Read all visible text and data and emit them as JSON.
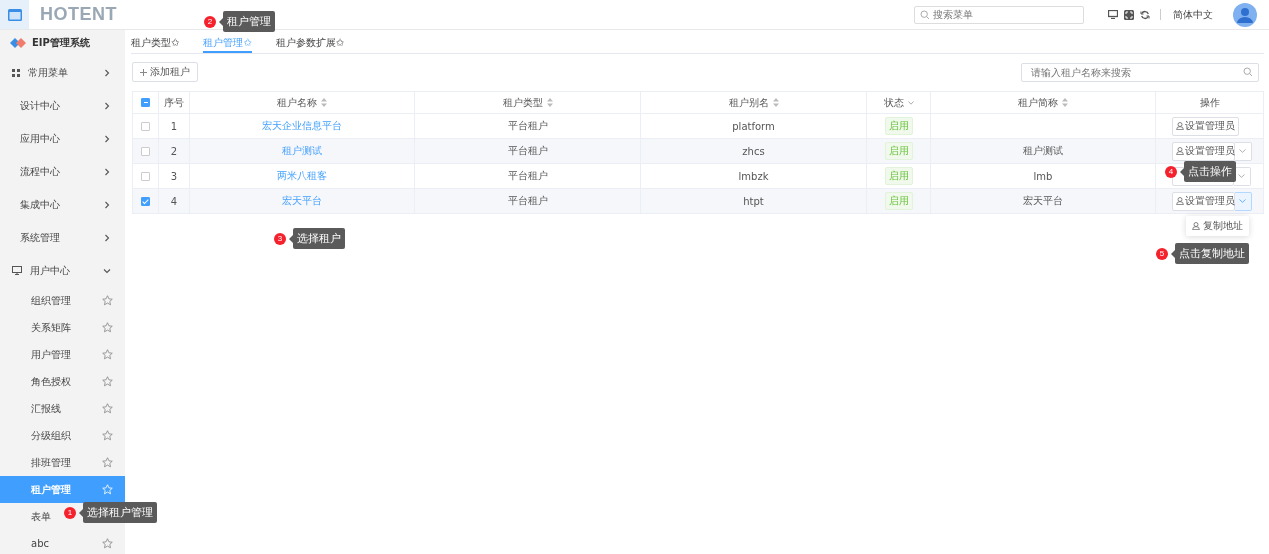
{
  "header": {
    "logo": "HOTENT",
    "search_placeholder": "搜索菜单",
    "language": "简体中文"
  },
  "sidebar": {
    "title": "EIP管理系统",
    "groups": [
      {
        "label": "常用菜单",
        "kind": "grid",
        "expanded": false
      },
      {
        "label": "设计中心",
        "kind": "plain",
        "expanded": false
      },
      {
        "label": "应用中心",
        "kind": "plain",
        "expanded": false
      },
      {
        "label": "流程中心",
        "kind": "plain",
        "expanded": false
      },
      {
        "label": "集成中心",
        "kind": "plain",
        "expanded": false
      },
      {
        "label": "系统管理",
        "kind": "plain",
        "expanded": false
      },
      {
        "label": "用户中心",
        "kind": "monitor",
        "expanded": true,
        "children": [
          {
            "label": "组织管理",
            "selected": false
          },
          {
            "label": "关系矩阵",
            "selected": false
          },
          {
            "label": "用户管理",
            "selected": false
          },
          {
            "label": "角色授权",
            "selected": false
          },
          {
            "label": "汇报线",
            "selected": false
          },
          {
            "label": "分级组织",
            "selected": false
          },
          {
            "label": "排班管理",
            "selected": false
          },
          {
            "label": "租户管理",
            "selected": true
          },
          {
            "label": "表单",
            "selected": false
          },
          {
            "label": "abc",
            "selected": false
          }
        ]
      }
    ]
  },
  "tabs": [
    {
      "label": "租户类型✩",
      "selected": false
    },
    {
      "label": "租户管理✩",
      "selected": true
    },
    {
      "label": "租户参数扩展✩",
      "selected": false
    }
  ],
  "toolbar": {
    "add_button": "添加租户",
    "search_placeholder": "请输入租户名称来搜索"
  },
  "table": {
    "select_all_partial": true,
    "columns": [
      {
        "label": "序号",
        "kind": "plain"
      },
      {
        "label": "租户名称",
        "kind": "sort"
      },
      {
        "label": "租户类型",
        "kind": "sort"
      },
      {
        "label": "租户别名",
        "kind": "sort"
      },
      {
        "label": "状态",
        "kind": "filter"
      },
      {
        "label": "租户简称",
        "kind": "sort"
      },
      {
        "label": "操作",
        "kind": "plain"
      }
    ],
    "rows": [
      {
        "index": "1",
        "name": "宏天企业信息平台",
        "type": "平台租户",
        "alias": "platform",
        "status": "启用",
        "enabled": true,
        "action": "设置管理员",
        "split": false,
        "menu_open": false,
        "selected": false
      },
      {
        "index": "2",
        "name": "租户测试",
        "type": "平台租户",
        "alias": "zhcs",
        "status": "启用",
        "enabled": true,
        "short_name": "租户测试",
        "action": "设置管理员",
        "split": true,
        "menu_open": false,
        "selected": false
      },
      {
        "index": "3",
        "name": "两米八租客",
        "type": "平台租户",
        "alias": "lmbzk",
        "status": "启用",
        "enabled": true,
        "short_name": "lmb",
        "split": true,
        "menu_open": false,
        "selected": false
      },
      {
        "index": "4",
        "name": "宏天平台",
        "type": "平台租户",
        "alias": "htpt",
        "status": "启用",
        "enabled": true,
        "short_name": "宏天平台",
        "action": "设置管理员",
        "split": true,
        "menu_open": true,
        "selected": true
      }
    ]
  },
  "action_menu": {
    "items": [
      "复制地址"
    ]
  },
  "callouts": [
    {
      "number": "1",
      "text": "选择租户管理"
    },
    {
      "number": "2",
      "text": "租户管理"
    },
    {
      "number": "3",
      "text": "选择租户"
    },
    {
      "number": "4",
      "text": "点击操作"
    },
    {
      "number": "5",
      "text": "点击复制地址"
    }
  ]
}
